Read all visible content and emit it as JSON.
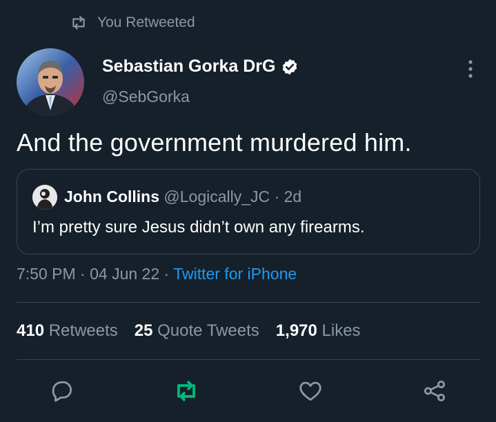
{
  "retweet_banner": {
    "text": "You Retweeted",
    "icon": "retweet-icon"
  },
  "author": {
    "name": "Sebastian Gorka DrG",
    "handle": "@SebGorka",
    "verified": true
  },
  "tweet": {
    "text": "And the government murdered him."
  },
  "quote": {
    "name": "John Collins",
    "handle": "@Logically_JC",
    "separator": "·",
    "age": "2d",
    "text": "I’m pretty sure Jesus didn’t own any firearms."
  },
  "meta": {
    "time": "7:50 PM",
    "sep1": "·",
    "date": "04 Jun 22",
    "sep2": "·",
    "source": "Twitter for iPhone"
  },
  "stats": {
    "retweets_count": "410",
    "retweets_label": "Retweets",
    "quotes_count": "25",
    "quotes_label": "Quote Tweets",
    "likes_count": "1,970",
    "likes_label": "Likes"
  },
  "actions": [
    "reply-icon",
    "retweet-icon",
    "like-icon",
    "share-icon"
  ],
  "colors": {
    "background": "#15202b",
    "muted": "#8b98a5",
    "link": "#1d9bf0",
    "retweet_active": "#00ba7c",
    "divider": "#38444d"
  }
}
